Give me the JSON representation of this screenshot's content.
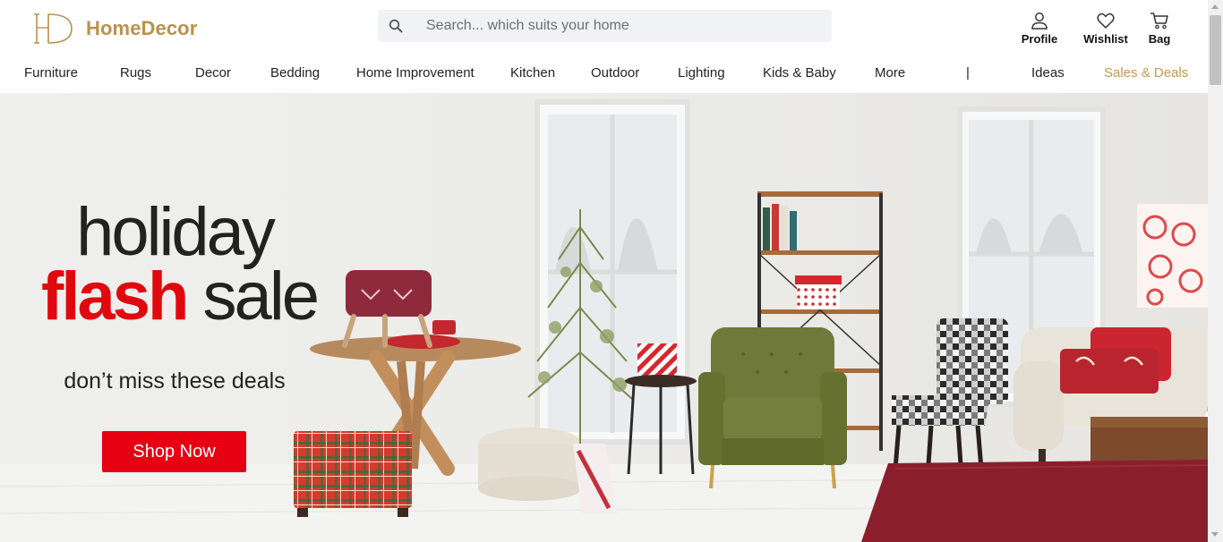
{
  "brand": {
    "name": "HomeDecor",
    "monogram": "HD",
    "color": "#b8924d"
  },
  "search": {
    "placeholder": "Search... which suits your home",
    "value": "",
    "icon": "search-icon"
  },
  "actions": {
    "profile": {
      "label": "Profile",
      "icon": "user-icon"
    },
    "wishlist": {
      "label": "Wishlist",
      "icon": "heart-icon"
    },
    "bag": {
      "label": "Bag",
      "icon": "shopping-cart-icon"
    }
  },
  "nav": {
    "items": [
      "Furniture",
      "Rugs",
      "Decor",
      "Bedding",
      "Home Improvement",
      "Kitchen",
      "Outdoor",
      "Lighting",
      "Kids & Baby",
      "More"
    ],
    "separator": "|",
    "ideas": "Ideas",
    "deals": "Sales & Deals",
    "deals_color": "#c4984e"
  },
  "hero": {
    "line1": "holiday",
    "line2_highlight": "flash",
    "line2_rest": "sale",
    "subtitle": "don’t miss these deals",
    "cta": "Shop Now",
    "accent_color": "#e0080e",
    "button_color": "#e60012"
  }
}
